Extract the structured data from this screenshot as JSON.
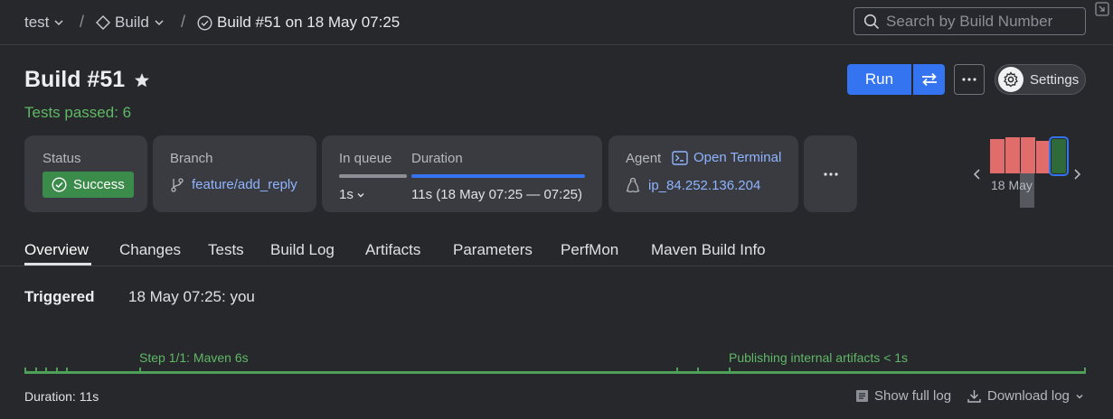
{
  "breadcrumb": {
    "project": "test",
    "build_config": "Build",
    "build_run": "Build #51 on 18 May 07:25"
  },
  "search": {
    "placeholder": "Search by Build Number"
  },
  "header": {
    "title": "Build #51",
    "subtitle": "Tests passed: 6",
    "run_label": "Run",
    "settings_label": "Settings"
  },
  "cards": {
    "status": {
      "label": "Status",
      "value": "Success"
    },
    "branch": {
      "label": "Branch",
      "value": "feature/add_reply"
    },
    "queue": {
      "label": "In queue",
      "value": "1s",
      "progress": 1.0
    },
    "duration": {
      "label": "Duration",
      "value": "11s (18 May 07:25 — 07:25)",
      "progress": 1.0
    },
    "agent": {
      "label": "Agent",
      "terminal_label": "Open Terminal",
      "value": "ip_84.252.136.204"
    }
  },
  "history": {
    "date": "18 May",
    "bars": [
      {
        "status": "failed",
        "level": 0.95
      },
      {
        "status": "failed",
        "level": 1.0
      },
      {
        "status": "failed",
        "level": 1.0
      },
      {
        "status": "failed",
        "level": 0.9
      },
      {
        "status": "success",
        "level": 0.95,
        "selected": true
      }
    ]
  },
  "tabs": [
    "Overview",
    "Changes",
    "Tests",
    "Build Log",
    "Artifacts",
    "Parameters",
    "PerfMon",
    "Maven Build Info"
  ],
  "overview": {
    "triggered_label": "Triggered",
    "triggered_value": "18 May 07:25: you",
    "step1": "Step 1/1: Maven 6s",
    "step2": "Publishing internal artifacts < 1s",
    "duration": "Duration: 11s",
    "show_full_log": "Show full log",
    "download_log": "Download log"
  },
  "colors": {
    "accent": "#3574f0",
    "success": "#5fb865",
    "failed": "#e06c6c",
    "link": "#8fb4ff"
  }
}
